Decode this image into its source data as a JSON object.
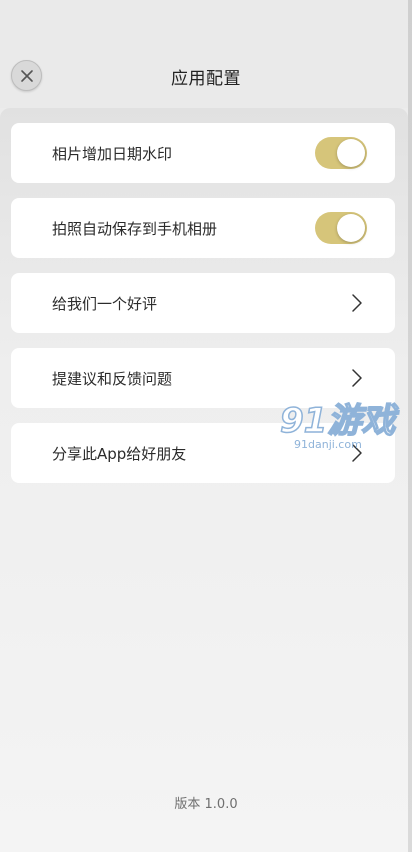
{
  "header": {
    "title": "应用配置",
    "close_icon": "close-icon"
  },
  "settings": [
    {
      "label": "相片增加日期水印",
      "control": "toggle",
      "enabled": true
    },
    {
      "label": "拍照自动保存到手机相册",
      "control": "toggle",
      "enabled": true
    },
    {
      "label": "给我们一个好评",
      "control": "chevron"
    },
    {
      "label": "提建议和反馈问题",
      "control": "chevron"
    },
    {
      "label": "分享此App给好朋友",
      "control": "chevron"
    }
  ],
  "footer": {
    "version": "版本 1.0.0"
  },
  "watermark": {
    "brand": "91游戏",
    "domain": "91danji.com"
  },
  "colors": {
    "toggle_on": "#d6c57a",
    "row_bg": "#ffffff",
    "page_bg": "#ececec",
    "watermark": "#8fb3d9"
  }
}
